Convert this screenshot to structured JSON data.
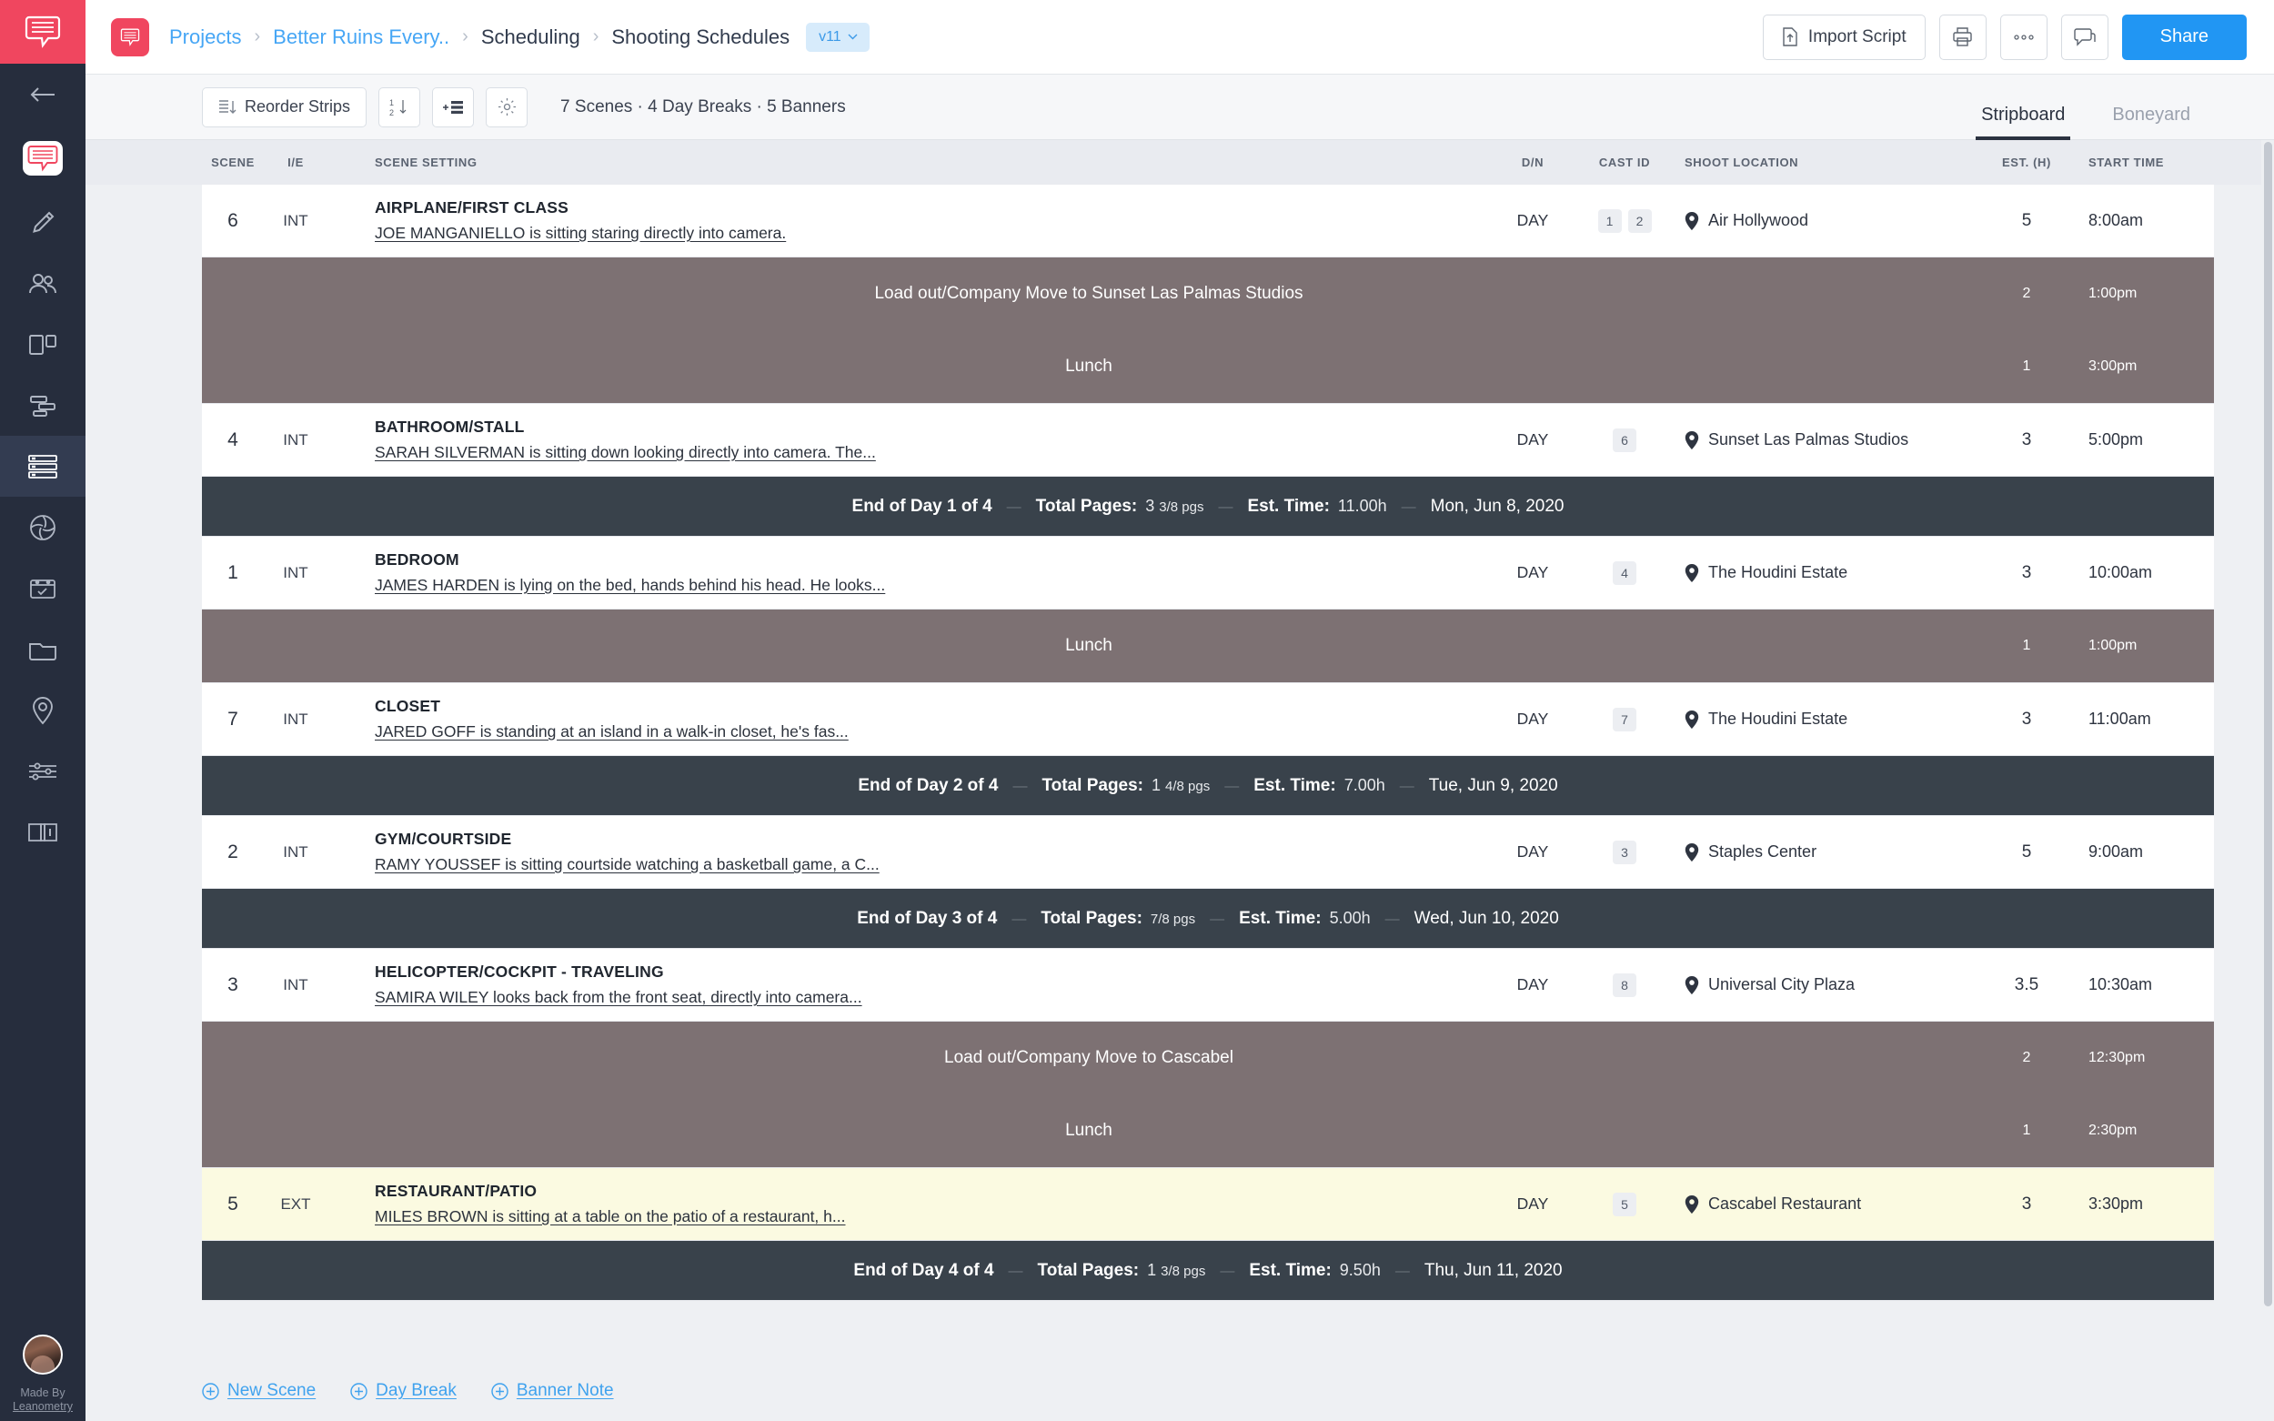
{
  "app": {
    "logo_icon": "speech-bubble-logo",
    "made_by_line1": "Made By",
    "made_by_line2": "Leanometry"
  },
  "rail": {
    "items": [
      {
        "icon": "back-arrow-icon",
        "name": "back"
      },
      {
        "icon": "speech-bubble-icon",
        "name": "script"
      },
      {
        "icon": "pencil-icon",
        "name": "write"
      },
      {
        "icon": "people-icon",
        "name": "cast"
      },
      {
        "icon": "columns-icon",
        "name": "breakdown"
      },
      {
        "icon": "gantt-icon",
        "name": "schedule"
      },
      {
        "icon": "stripboard-icon",
        "name": "stripboard"
      },
      {
        "icon": "shutter-icon",
        "name": "shotlist"
      },
      {
        "icon": "clapper-calendar-icon",
        "name": "callsheets"
      },
      {
        "icon": "folder-icon",
        "name": "files"
      },
      {
        "icon": "location-pin-icon",
        "name": "locations"
      },
      {
        "icon": "sliders-icon",
        "name": "settings"
      },
      {
        "icon": "book-icon",
        "name": "help"
      }
    ],
    "active_index": 6
  },
  "header": {
    "breadcrumbs": [
      {
        "label": "Projects",
        "link": true
      },
      {
        "label": "Better Ruins Every..",
        "link": true
      },
      {
        "label": "Scheduling",
        "link": false
      },
      {
        "label": "Shooting Schedules",
        "link": false
      }
    ],
    "version_pill": "v11",
    "import_script_label": "Import Script",
    "print_icon": "printer-icon",
    "more_icon": "ellipsis-icon",
    "comments_icon": "comment-bubble-icon",
    "share_label": "Share"
  },
  "toolbar": {
    "reorder_label": "Reorder Strips",
    "reorder_icon": "reorder-icon",
    "sort_icon": "sort-1-2-down-icon",
    "add_strip_icon": "add-strip-icon",
    "gear_icon": "gear-icon",
    "meta": "7 Scenes · 4 Day Breaks · 5 Banners",
    "tabs": [
      {
        "label": "Stripboard",
        "active": true
      },
      {
        "label": "Boneyard",
        "active": false
      }
    ]
  },
  "table": {
    "columns": {
      "scene": "SCENE",
      "ie": "I/E",
      "setting": "SCENE SETTING",
      "dn": "D/N",
      "cast": "CAST ID",
      "location": "SHOOT LOCATION",
      "est": "EST. (H)",
      "start": "START TIME"
    },
    "rows": [
      {
        "type": "scene",
        "scene": "6",
        "ie": "INT",
        "title": "AIRPLANE/FIRST CLASS",
        "desc": "JOE MANGANIELLO is sitting staring directly into camera.",
        "dn": "DAY",
        "cast": [
          "1",
          "2"
        ],
        "location": "Air Hollywood",
        "est": "5",
        "start": "8:00am",
        "highlight": false
      },
      {
        "type": "banner-group",
        "banners": [
          {
            "text": "Load out/Company Move to Sunset Las Palmas Studios",
            "est": "2",
            "start": "1:00pm"
          },
          {
            "text": "Lunch",
            "est": "1",
            "start": "3:00pm"
          }
        ]
      },
      {
        "type": "scene",
        "scene": "4",
        "ie": "INT",
        "title": "BATHROOM/STALL",
        "desc": "SARAH SILVERMAN is sitting down looking directly into camera. The...",
        "dn": "DAY",
        "cast": [
          "6"
        ],
        "location": "Sunset Las Palmas Studios",
        "est": "3",
        "start": "5:00pm",
        "highlight": false
      },
      {
        "type": "daybreak",
        "title": "End of Day 1 of 4",
        "pages_label": "Total Pages:",
        "pages_whole": "3",
        "pages_frac": "3/8",
        "pages_unit": "pgs",
        "time_label": "Est. Time:",
        "time_value": "11.00h",
        "date": "Mon, Jun 8, 2020"
      },
      {
        "type": "scene",
        "scene": "1",
        "ie": "INT",
        "title": "BEDROOM",
        "desc": "JAMES HARDEN is lying on the bed, hands behind his head. He looks...",
        "dn": "DAY",
        "cast": [
          "4"
        ],
        "location": "The Houdini Estate",
        "est": "3",
        "start": "10:00am",
        "highlight": false
      },
      {
        "type": "banner-group",
        "banners": [
          {
            "text": "Lunch",
            "est": "1",
            "start": "1:00pm"
          }
        ]
      },
      {
        "type": "scene",
        "scene": "7",
        "ie": "INT",
        "title": "CLOSET",
        "desc": "JARED GOFF is standing at an island in a walk-in closet, he's fas...",
        "dn": "DAY",
        "cast": [
          "7"
        ],
        "location": "The Houdini Estate",
        "est": "3",
        "start": "11:00am",
        "highlight": false
      },
      {
        "type": "daybreak",
        "title": "End of Day 2 of 4",
        "pages_label": "Total Pages:",
        "pages_whole": "1",
        "pages_frac": "4/8",
        "pages_unit": "pgs",
        "time_label": "Est. Time:",
        "time_value": "7.00h",
        "date": "Tue, Jun 9, 2020"
      },
      {
        "type": "scene",
        "scene": "2",
        "ie": "INT",
        "title": "GYM/COURTSIDE",
        "desc": "RAMY YOUSSEF is sitting courtside watching a basketball game, a C...",
        "dn": "DAY",
        "cast": [
          "3"
        ],
        "location": "Staples Center",
        "est": "5",
        "start": "9:00am",
        "highlight": false
      },
      {
        "type": "daybreak",
        "title": "End of Day 3 of 4",
        "pages_label": "Total Pages:",
        "pages_whole": "",
        "pages_frac": "7/8",
        "pages_unit": "pgs",
        "time_label": "Est. Time:",
        "time_value": "5.00h",
        "date": "Wed, Jun 10, 2020"
      },
      {
        "type": "scene",
        "scene": "3",
        "ie": "INT",
        "title": "HELICOPTER/COCKPIT - TRAVELING",
        "desc": "SAMIRA WILEY looks back from the front seat, directly into camera...",
        "dn": "DAY",
        "cast": [
          "8"
        ],
        "location": "Universal City Plaza",
        "est": "3.5",
        "start": "10:30am",
        "highlight": false
      },
      {
        "type": "banner-group",
        "banners": [
          {
            "text": "Load out/Company Move to Cascabel",
            "est": "2",
            "start": "12:30pm"
          },
          {
            "text": "Lunch",
            "est": "1",
            "start": "2:30pm"
          }
        ]
      },
      {
        "type": "scene",
        "scene": "5",
        "ie": "EXT",
        "title": "RESTAURANT/PATIO",
        "desc": "MILES BROWN is sitting at a table on the patio of a restaurant, h...",
        "dn": "DAY",
        "cast": [
          "5"
        ],
        "location": "Cascabel Restaurant",
        "est": "3",
        "start": "3:30pm",
        "highlight": true
      },
      {
        "type": "daybreak",
        "title": "End of Day 4 of 4",
        "pages_label": "Total Pages:",
        "pages_whole": "1",
        "pages_frac": "3/8",
        "pages_unit": "pgs",
        "time_label": "Est. Time:",
        "time_value": "9.50h",
        "date": "Thu, Jun 11, 2020"
      }
    ]
  },
  "footer": {
    "actions": [
      {
        "label": "New Scene",
        "icon": "plus-circle-icon"
      },
      {
        "label": "Day Break",
        "icon": "plus-circle-icon"
      },
      {
        "label": "Banner Note",
        "icon": "plus-circle-icon"
      }
    ]
  },
  "colors": {
    "brand": "#f0465f",
    "accent_blue": "#2196f3",
    "banner": "#7d7173",
    "daybreak": "#39424b",
    "highlight": "#fbfae1"
  }
}
